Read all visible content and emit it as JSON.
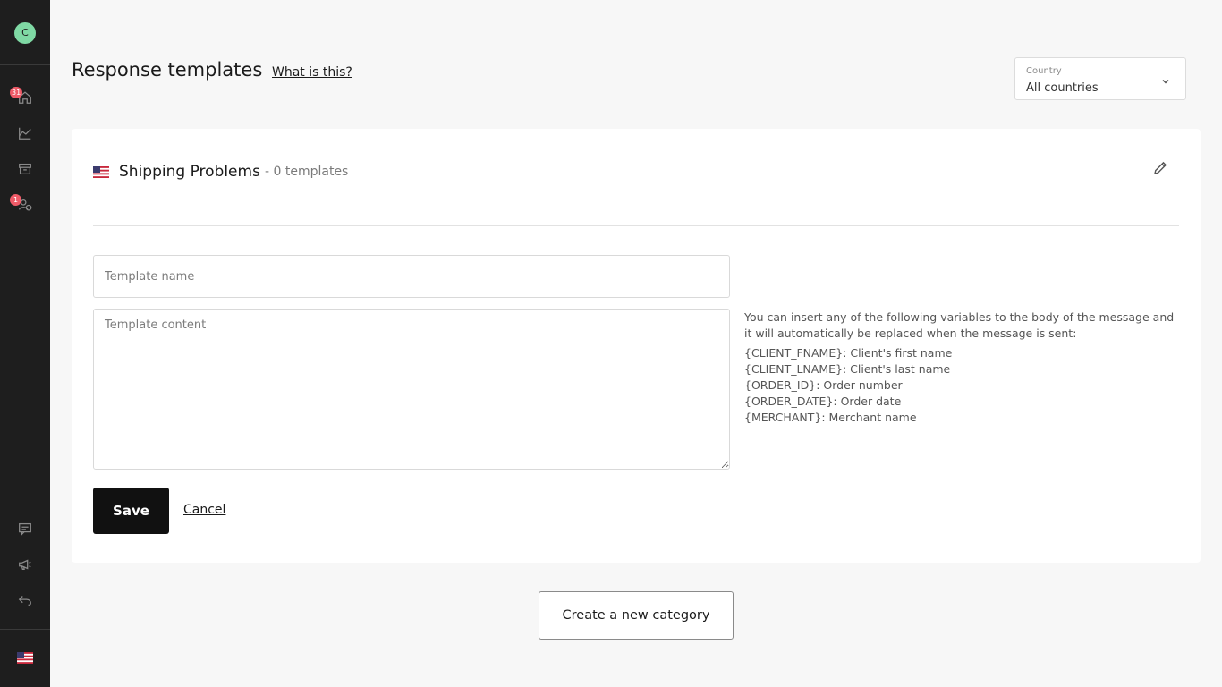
{
  "sidebar": {
    "avatar_initial": "C",
    "nav": [
      {
        "icon": "home-icon",
        "badge": "31"
      },
      {
        "icon": "chart-icon",
        "badge": null
      },
      {
        "icon": "archive-icon",
        "badge": null
      },
      {
        "icon": "users-money-icon",
        "badge": "1"
      }
    ],
    "bottom": [
      {
        "icon": "chat-icon"
      },
      {
        "icon": "megaphone-icon"
      },
      {
        "icon": "undo-icon"
      }
    ],
    "flag_icon": "us-flag-icon"
  },
  "header": {
    "title": "Response templates",
    "help_link": "What is this?",
    "country": {
      "label": "Country",
      "value": "All countries"
    }
  },
  "category": {
    "flag_icon": "us-flag-icon",
    "name": "Shipping Problems",
    "count_text": "- 0 templates"
  },
  "form": {
    "name_placeholder": "Template name",
    "content_placeholder": "Template content",
    "save_label": "Save",
    "cancel_label": "Cancel"
  },
  "variables": {
    "intro": "You can insert any of the following variables to the body of the message and it will automatically be replaced when the message is sent:",
    "items": [
      "{CLIENT_FNAME}: Client's first name",
      "{CLIENT_LNAME}: Client's last name",
      "{ORDER_ID}: Order number",
      "{ORDER_DATE}: Order date",
      "{MERCHANT}: Merchant name"
    ]
  },
  "create_category_label": "Create a new category",
  "colors": {
    "sidebar": "#1e1e1e",
    "avatar": "#7fd9a4",
    "badge": "#ef5b68",
    "primary_button": "#111111"
  }
}
